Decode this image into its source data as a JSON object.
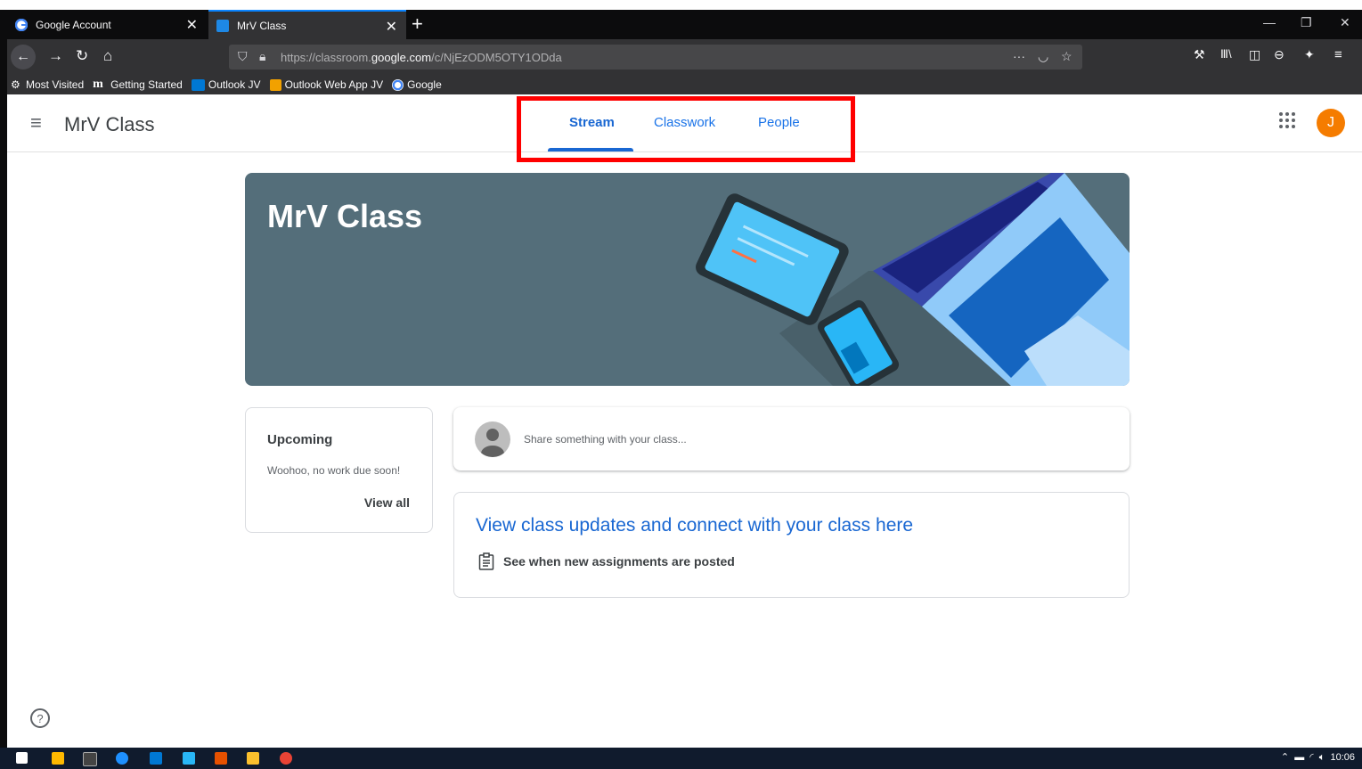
{
  "browser": {
    "tabs": [
      {
        "title": "Google Account",
        "favicon_color": "#4285f4"
      },
      {
        "title": "MrV Class",
        "favicon_color": "#1e88e5"
      }
    ],
    "new_tab_label": "+",
    "close_glyph": "✕",
    "url_prefix": "https://classroom.",
    "url_domain": "google.com",
    "url_path": "/c/NjEzODM5OTY1ODda",
    "bookmarks": [
      {
        "label": "Most Visited",
        "icon": "gear-icon"
      },
      {
        "label": "Getting Started",
        "icon": "m-icon"
      },
      {
        "label": "Outlook JV",
        "icon": "outlook-icon"
      },
      {
        "label": "Outlook Web App JV",
        "icon": "outlook-icon"
      },
      {
        "label": "Google",
        "icon": "google-icon"
      }
    ]
  },
  "classroom": {
    "class_name": "MrV Class",
    "tabs": [
      "Stream",
      "Classwork",
      "People"
    ],
    "active_tab": "Stream",
    "avatar_letter": "J",
    "banner_title": "MrV Class",
    "upcoming": {
      "title": "Upcoming",
      "text": "Woohoo, no work due soon!",
      "link": "View all"
    },
    "share_placeholder": "Share something with your class...",
    "info": {
      "title": "View class updates and connect with your class here",
      "row": "See when new assignments are posted"
    },
    "help_glyph": "?"
  },
  "taskbar": {
    "clock": "10:06"
  },
  "colors": {
    "accent": "#1967d2",
    "highlight": "#ff0000",
    "banner": "#546e7a",
    "avatar": "#f57c00"
  }
}
